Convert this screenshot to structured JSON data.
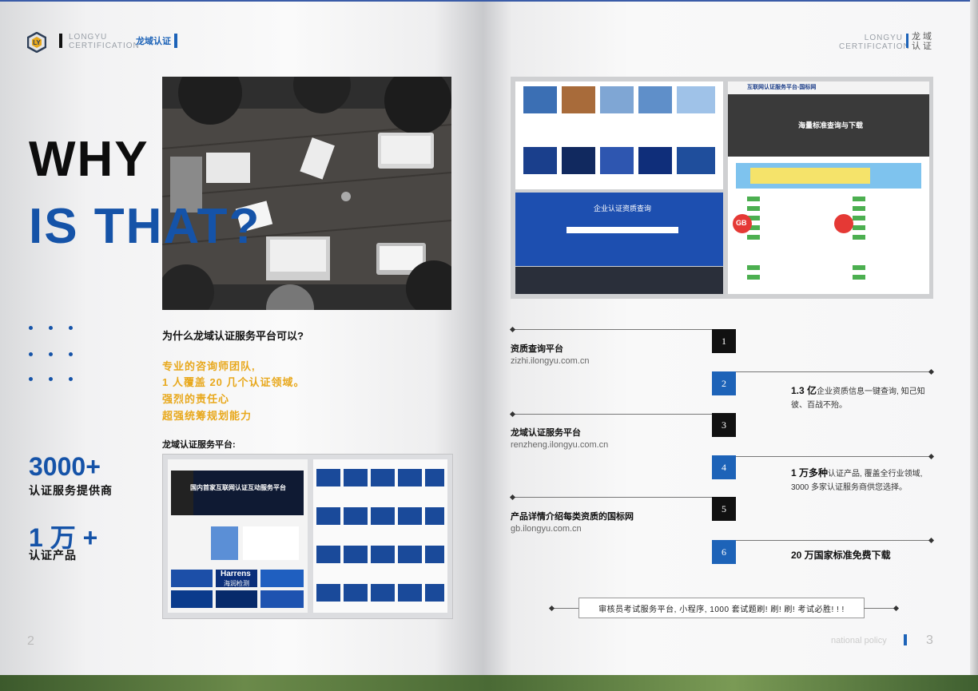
{
  "left": {
    "brand_en_1": "LONGYU",
    "brand_en_2": "CERTIFICATION",
    "brand_cn": "龙域认证",
    "headline_1": "WHY",
    "headline_2": "IS THAT?",
    "question": "为什么龙域认证服务平台可以?",
    "yellow_lines": [
      "专业的咨询师团队,",
      "1 人覆盖 20 几个认证领域。",
      "强烈的责任心",
      "超强统筹规划能力"
    ],
    "stat1_value": "3000+",
    "stat1_label": "认证服务提供商",
    "stat2_value": "1 万 +",
    "stat2_label": "认证产品",
    "platform_label": "龙域认证服务平台:",
    "screenshot_texts": {
      "banner": "国内首家互联网认证互动服务平台",
      "harrens": "Harrens",
      "harrens_cn": "海润检测"
    },
    "page_number": "2"
  },
  "right": {
    "brand_en_1": "LONGYU",
    "brand_en_2": "CERTIFICATION",
    "brand_cn_1": "龙 域",
    "brand_cn_2": "认 证",
    "screenshot_texts": {
      "site_title": "互联网认证服务平台-国标网",
      "hero": "海量标准查询与下载",
      "search_title": "企业认证资质查询",
      "gb": "GB"
    },
    "items": [
      {
        "num": "1",
        "title": "资质查询平台",
        "url": "zizhi.ilongyu.com.cn"
      },
      {
        "num": "2",
        "desc_bold": "1.3 亿",
        "desc": "企业资质信息一键查询, 知己知彼、百战不殆。"
      },
      {
        "num": "3",
        "title": "龙域认证服务平台",
        "url": "renzheng.ilongyu.com.cn"
      },
      {
        "num": "4",
        "desc_bold": "1 万多种",
        "desc": "认证产品, 覆盖全行业领域, 3000 多家认证服务商供您选择。"
      },
      {
        "num": "5",
        "title": "产品详情介绍每类资质的国标网",
        "url": "gb.ilongyu.com.cn"
      },
      {
        "num": "6",
        "desc_bold": "20 万国家标准免费下载",
        "desc": ""
      }
    ],
    "bottom_note": "审核员考试服务平台, 小程序, 1000 套试题刷! 刷! 刷! 考试必胜! ! !",
    "footer_text": "national policy",
    "page_number": "3"
  }
}
